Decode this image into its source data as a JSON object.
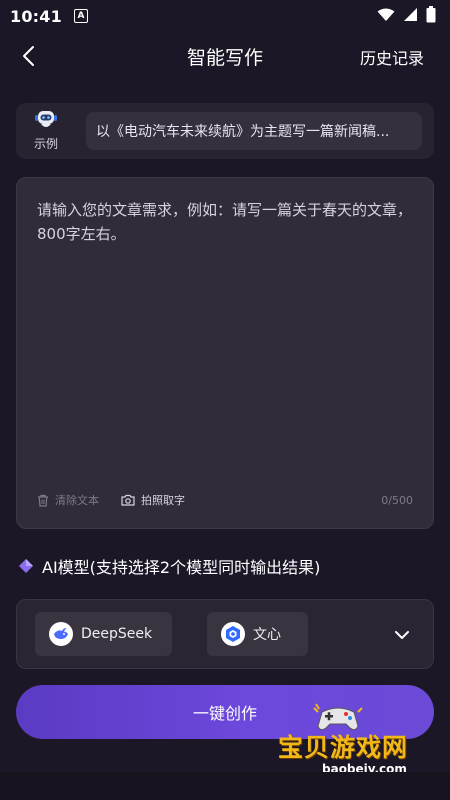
{
  "status_bar": {
    "time": "10:41",
    "notification_letter": "A"
  },
  "header": {
    "title": "智能写作",
    "history_label": "历史记录"
  },
  "example": {
    "tag_label": "示例",
    "text": "以《电动汽车未来续航》为主题写一篇新闻稿..."
  },
  "editor": {
    "value": "",
    "placeholder": "请输入您的文章需求，例如：请写一篇关于春天的文章，800字左右。",
    "clear_label": "清除文本",
    "photo_label": "拍照取字",
    "counter": "0/500"
  },
  "models": {
    "heading": "AI模型(支持选择2个模型同时输出结果)",
    "items": [
      {
        "label": "DeepSeek",
        "icon": "deepseek-logo-icon"
      },
      {
        "label": "文心",
        "icon": "wenxin-logo-icon"
      }
    ]
  },
  "actions": {
    "create_label": "一键创作"
  },
  "watermark": {
    "title": "宝贝游戏网",
    "site": "baobeiy.com"
  },
  "colors": {
    "background": "#1c1726",
    "accent": "#6d48dc",
    "watermark": "#f2b817"
  }
}
